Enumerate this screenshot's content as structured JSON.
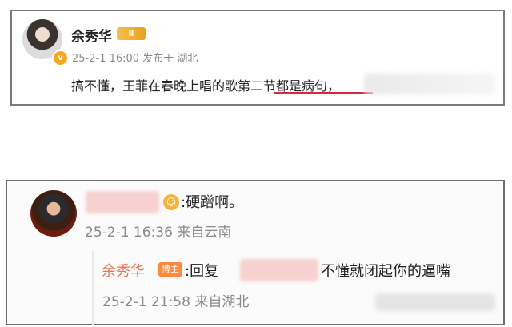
{
  "post": {
    "author": "余秀华",
    "level_badge": "Ⅱ",
    "verified_badge": "v",
    "meta": "25-2-1 16:00  发布于 湖北",
    "text": "搞不懂，王菲在春晚上唱的歌第二节都是病句，"
  },
  "comment": {
    "text": ":硬蹭啊。",
    "meta": "25-2-1 16:36  来自云南",
    "reply": {
      "author": "余秀华",
      "author_badge": "博主",
      "prefix": ":回复",
      "text": "不懂就闭起你的逼嘴",
      "meta": "25-2-1 21:58  来自湖北"
    }
  },
  "colors": {
    "underline": "#d9283e",
    "reply_author": "#eb7350",
    "host_badge": "#ff8a3d"
  }
}
